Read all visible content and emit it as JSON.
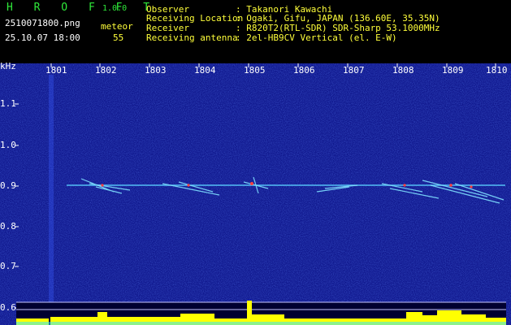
{
  "app": {
    "logo": "H R O F F T",
    "version": "1.0.0",
    "filename": "2510071800.png",
    "timestamp": "25.10.07 18:00",
    "mode": "meteor",
    "count": "55"
  },
  "info": {
    "labels": [
      "Observer",
      "Receiving Location",
      "Receiver",
      "Receiving antenna"
    ],
    "values": [
      ": Takanori Kawachi",
      ": Ogaki, Gifu, JAPAN (136.60E, 35.35N)",
      ": R820T2(RTL-SDR) SDR-Sharp 53.1000MHz",
      ": 2el-HB9CV Vertical (el. E-W)"
    ]
  },
  "axis": {
    "y_unit": "kHz",
    "y_ticks": [
      "1.1",
      "1.0",
      "0.9",
      "0.8",
      "0.7",
      "0.6"
    ],
    "x_ticks": [
      "1801",
      "1802",
      "1803",
      "1804",
      "1805",
      "1806",
      "1807",
      "1808",
      "1809",
      "1810"
    ]
  },
  "colors": {
    "background": "#11198f",
    "text_green": "#2fe83a",
    "text_yellow": "#ffff3a",
    "signal_line": "#5ad0ff",
    "level_bars": "#ffff00"
  }
}
